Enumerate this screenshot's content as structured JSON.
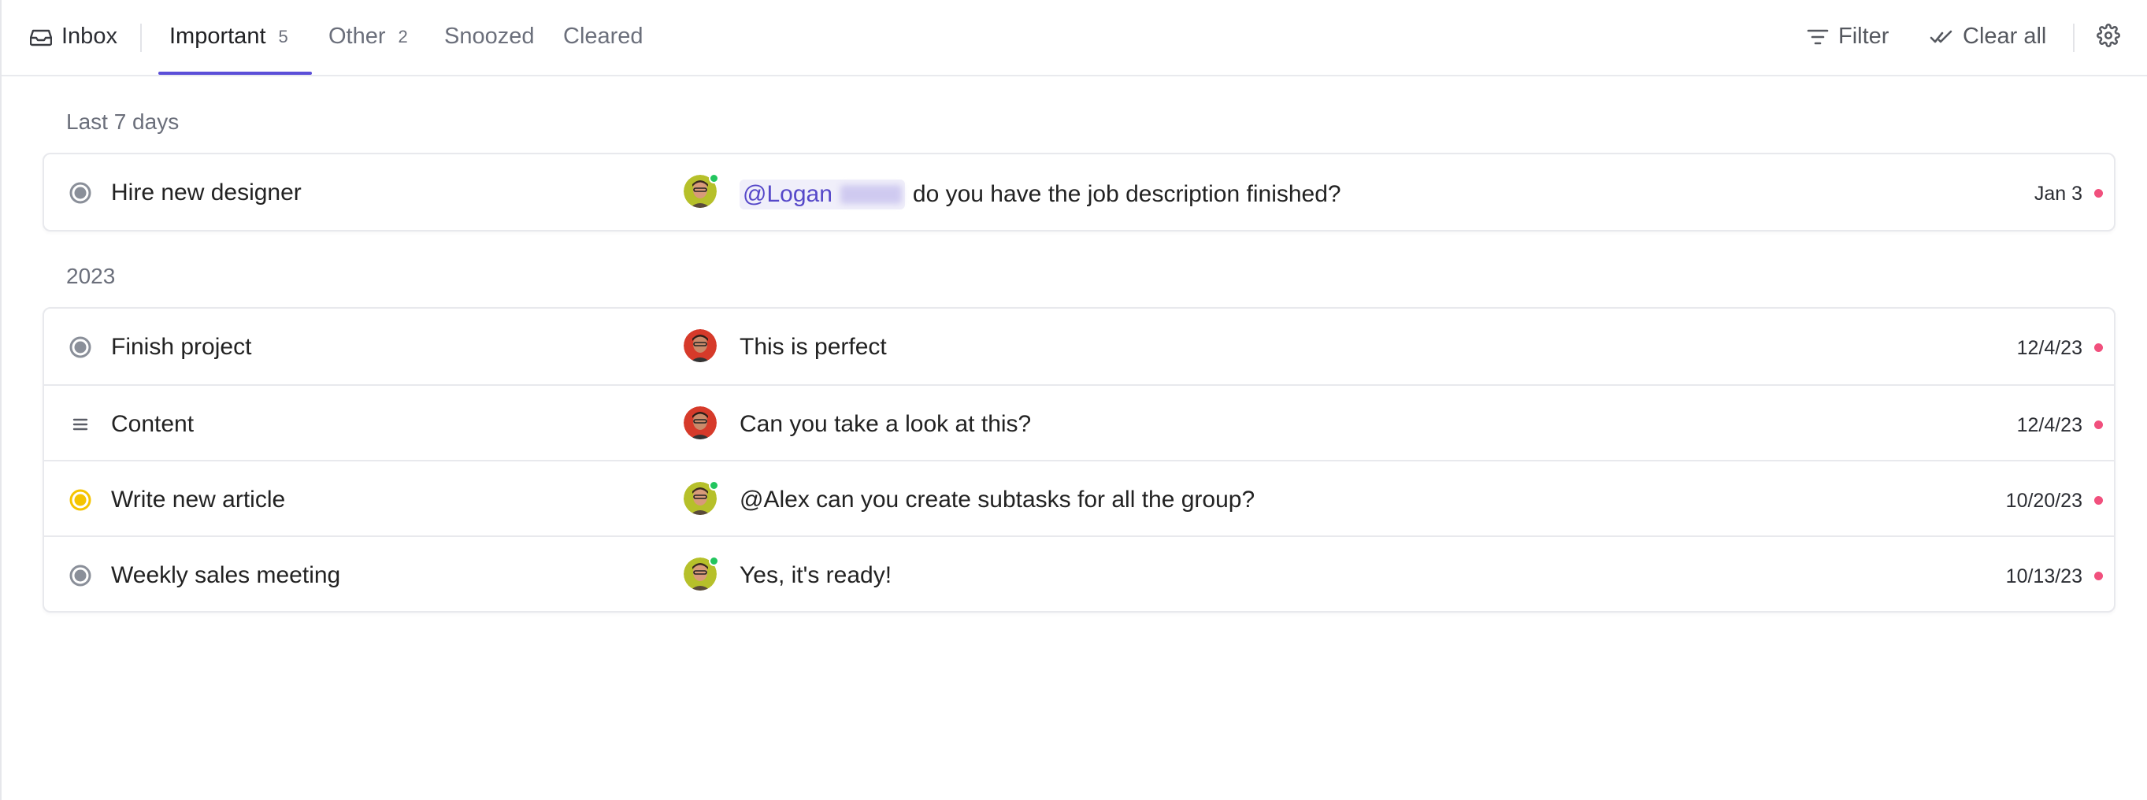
{
  "header": {
    "inbox_label": "Inbox",
    "tabs": [
      {
        "label": "Important",
        "count": "5"
      },
      {
        "label": "Other",
        "count": "2"
      },
      {
        "label": "Snoozed"
      },
      {
        "label": "Cleared"
      }
    ],
    "filter_label": "Filter",
    "clear_all_label": "Clear all",
    "icons": {
      "inbox": "inbox-tray-icon",
      "filter": "filter-lines-icon",
      "clear_all": "double-check-icon",
      "settings": "gear-icon"
    }
  },
  "sections": [
    {
      "title": "Last 7 days",
      "items": [
        {
          "task": "Hire new designer",
          "status": "gray-circle",
          "mention": "@Logan",
          "message": "do you have the job description finished?",
          "date": "Jan 3",
          "avatar_online": true
        }
      ]
    },
    {
      "title": "2023",
      "items": [
        {
          "task": "Finish project",
          "status": "gray-circle",
          "message": "This is perfect",
          "date": "12/4/23",
          "avatar_online": false
        },
        {
          "task": "Content",
          "status": "list-lines",
          "message": "Can you take a look at this?",
          "date": "12/4/23",
          "avatar_online": false
        },
        {
          "task": "Write new article",
          "status": "yellow-circle",
          "message": "@Alex can you create subtasks for all the group?",
          "date": "10/20/23",
          "avatar_online": true
        },
        {
          "task": "Weekly sales meeting",
          "status": "gray-circle",
          "message": "Yes, it's ready!",
          "date": "10/13/23",
          "avatar_online": true
        }
      ]
    }
  ],
  "colors": {
    "accent": "#5b4fd8",
    "unread_dot": "#f1507d",
    "online": "#22c55e",
    "status_gray": "#8a8f99",
    "status_yellow": "#f5c400"
  }
}
